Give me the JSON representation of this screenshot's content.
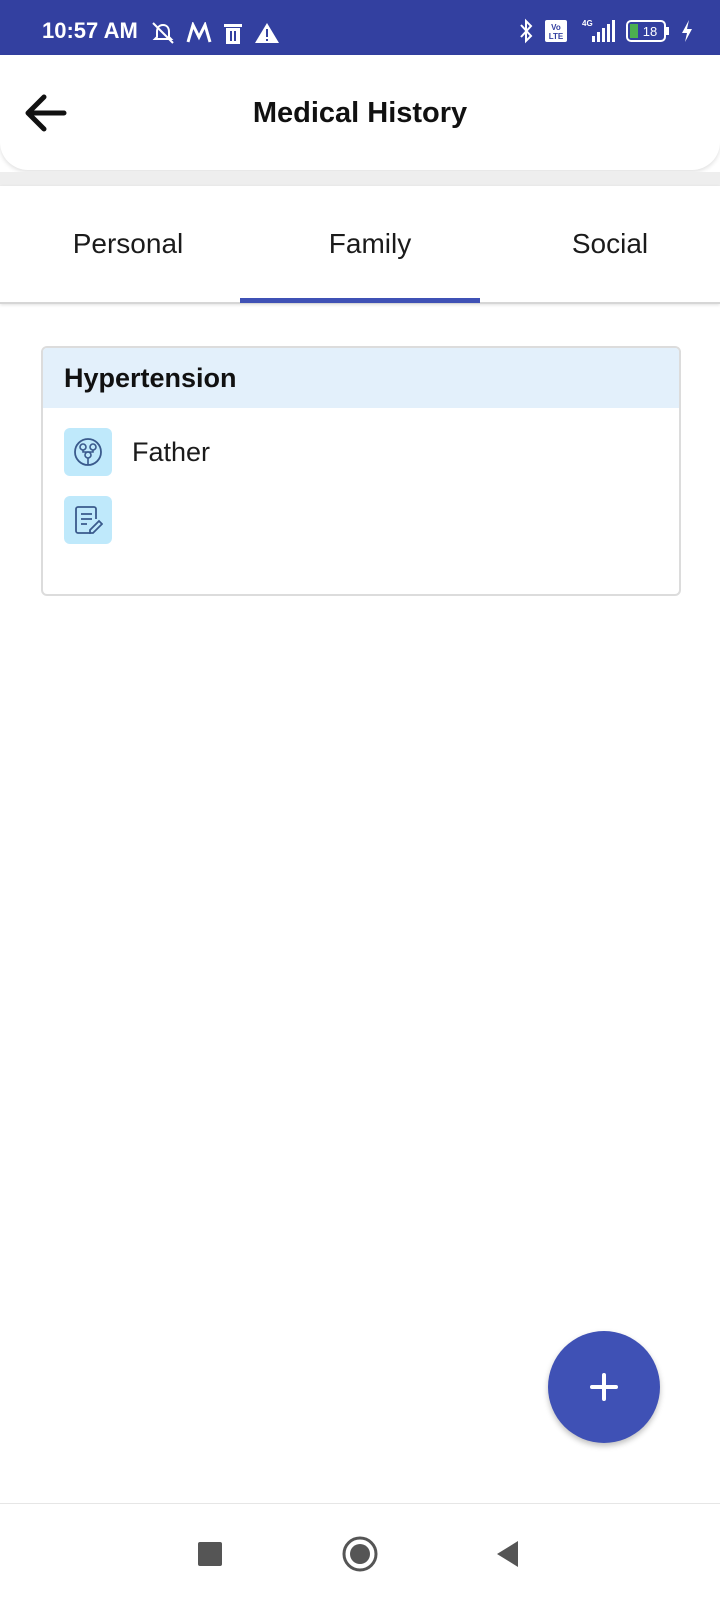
{
  "status_bar": {
    "time": "10:57 AM",
    "battery_level": "18",
    "network": "4G",
    "volte": "Vo LTE",
    "left_icons": [
      "alarm-off-icon",
      "app-m-icon",
      "trash-icon",
      "warning-icon"
    ],
    "right_icons": [
      "bluetooth-icon",
      "volte-icon",
      "signal-icon",
      "battery-icon",
      "charging-icon"
    ],
    "background": "#3340a0"
  },
  "app_bar": {
    "title": "Medical History",
    "back_icon": "arrow-left-icon"
  },
  "tabs": {
    "items": [
      {
        "label": "Personal",
        "selected": false
      },
      {
        "label": "Family",
        "selected": true
      },
      {
        "label": "Social",
        "selected": false
      }
    ],
    "indicator_color": "#3f51b5"
  },
  "records": [
    {
      "condition": "Hypertension",
      "relation": "Father",
      "relation_icon": "family-tree-icon",
      "notes": "",
      "notes_icon": "edit-note-icon"
    }
  ],
  "fab": {
    "icon": "plus-icon",
    "color": "#3f51b5"
  },
  "nav_bar": {
    "buttons": [
      "recents-square-icon",
      "home-circle-icon",
      "back-triangle-icon"
    ]
  }
}
